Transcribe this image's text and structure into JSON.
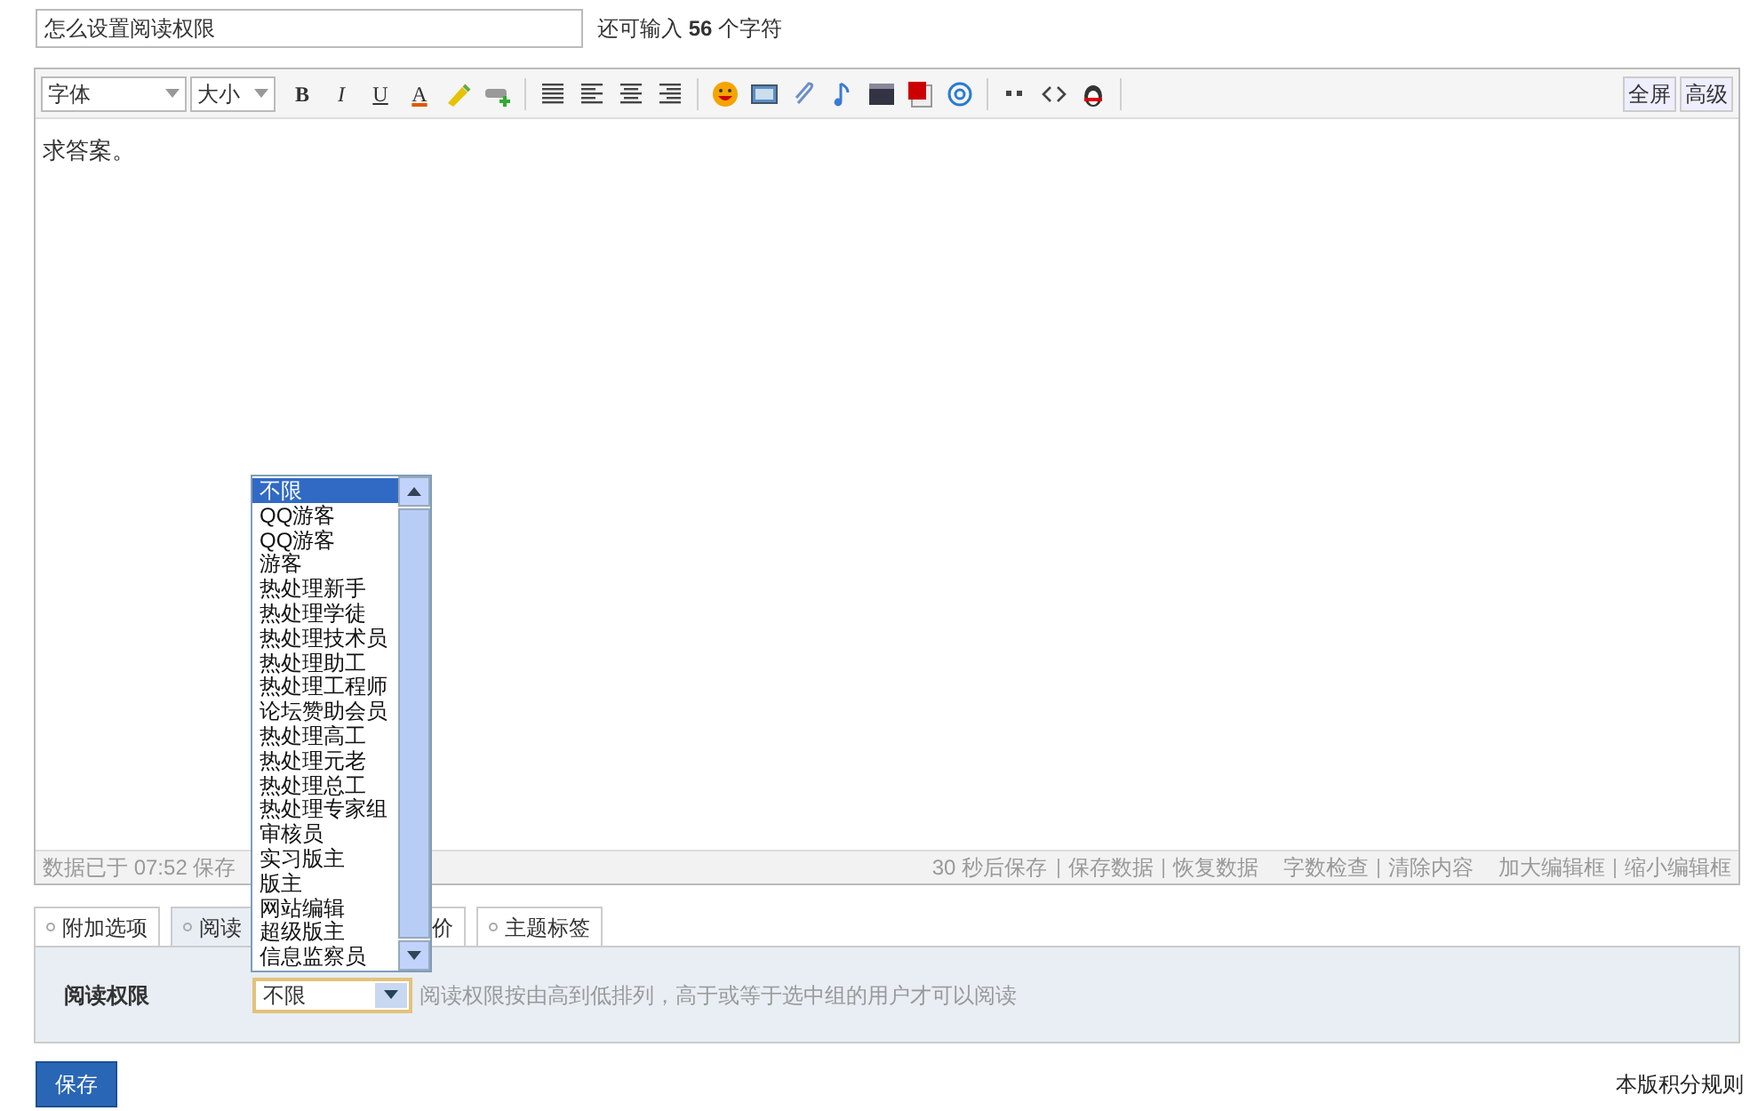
{
  "title_field": {
    "value": "怎么设置阅读权限"
  },
  "char_counter": {
    "prefix": "还可输入",
    "count": "56",
    "suffix": "个字符"
  },
  "toolbar": {
    "font_select": "字体",
    "size_select": "大小",
    "format_buttons": [
      "B",
      "I",
      "U",
      "A"
    ],
    "right_buttons": [
      "全屏",
      "高级"
    ]
  },
  "editor": {
    "body": "求答案。"
  },
  "status_bar": {
    "saved_at": "数据已于 07:52 保存",
    "actions_left": [
      "30 秒后保存",
      "保存数据",
      "恢复数据"
    ],
    "actions_mid": [
      "字数检查",
      "清除内容"
    ],
    "actions_right": [
      "加大编辑框",
      "缩小编辑框"
    ]
  },
  "tabs": [
    {
      "label": "附加选项",
      "selected": false
    },
    {
      "label": "阅读",
      "selected": true
    },
    {
      "label": "价",
      "selected": false
    },
    {
      "label": "主题标签",
      "selected": false
    }
  ],
  "read_permission": {
    "label": "阅读权限",
    "value": "不限",
    "hint": "阅读权限按由高到低排列，高于或等于选中组的用户才可以阅读"
  },
  "dropdown_options": [
    {
      "label": "不限",
      "selected": true
    },
    {
      "label": "QQ游客",
      "selected": false
    },
    {
      "label": "QQ游客",
      "selected": false
    },
    {
      "label": "游客",
      "selected": false
    },
    {
      "label": "热处理新手",
      "selected": false
    },
    {
      "label": "热处理学徒",
      "selected": false
    },
    {
      "label": "热处理技术员",
      "selected": false
    },
    {
      "label": "热处理助工",
      "selected": false
    },
    {
      "label": "热处理工程师",
      "selected": false
    },
    {
      "label": "论坛赞助会员",
      "selected": false
    },
    {
      "label": "热处理高工",
      "selected": false
    },
    {
      "label": "热处理元老",
      "selected": false
    },
    {
      "label": "热处理总工",
      "selected": false
    },
    {
      "label": "热处理专家组",
      "selected": false
    },
    {
      "label": "审核员",
      "selected": false
    },
    {
      "label": "实习版主",
      "selected": false
    },
    {
      "label": "版主",
      "selected": false
    },
    {
      "label": "网站编辑",
      "selected": false
    },
    {
      "label": "超级版主",
      "selected": false
    },
    {
      "label": "信息监察员",
      "selected": false
    }
  ],
  "save_button": "保存",
  "footer_link": "本版积分规则"
}
